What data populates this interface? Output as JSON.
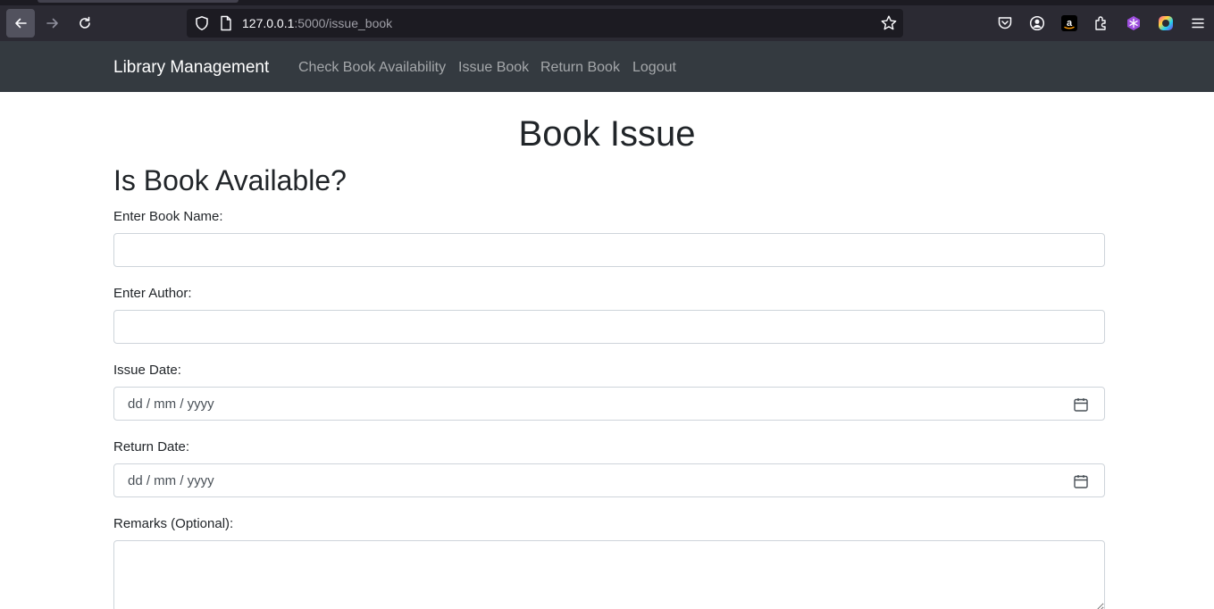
{
  "browser": {
    "url_host": "127.0.0.1",
    "url_path": ":5000/issue_book"
  },
  "navbar": {
    "brand": "Library Management",
    "links": [
      {
        "label": "Check Book Availability"
      },
      {
        "label": "Issue Book"
      },
      {
        "label": "Return Book"
      },
      {
        "label": "Logout"
      }
    ]
  },
  "main": {
    "title": "Book Issue",
    "section_title": "Is Book Available?",
    "fields": {
      "book_name": {
        "label": "Enter Book Name:",
        "value": ""
      },
      "author": {
        "label": "Enter Author:",
        "value": ""
      },
      "issue_date": {
        "label": "Issue Date:",
        "placeholder": "dd / mm / yyyy"
      },
      "return_date": {
        "label": "Return Date:",
        "placeholder": "dd / mm / yyyy"
      },
      "remarks": {
        "label": "Remarks (Optional):",
        "value": ""
      }
    }
  },
  "colors": {
    "navbar_bg": "#343a40",
    "browser_toolbar": "#2b2a33",
    "input_border": "#ced4da",
    "text": "#212529"
  }
}
